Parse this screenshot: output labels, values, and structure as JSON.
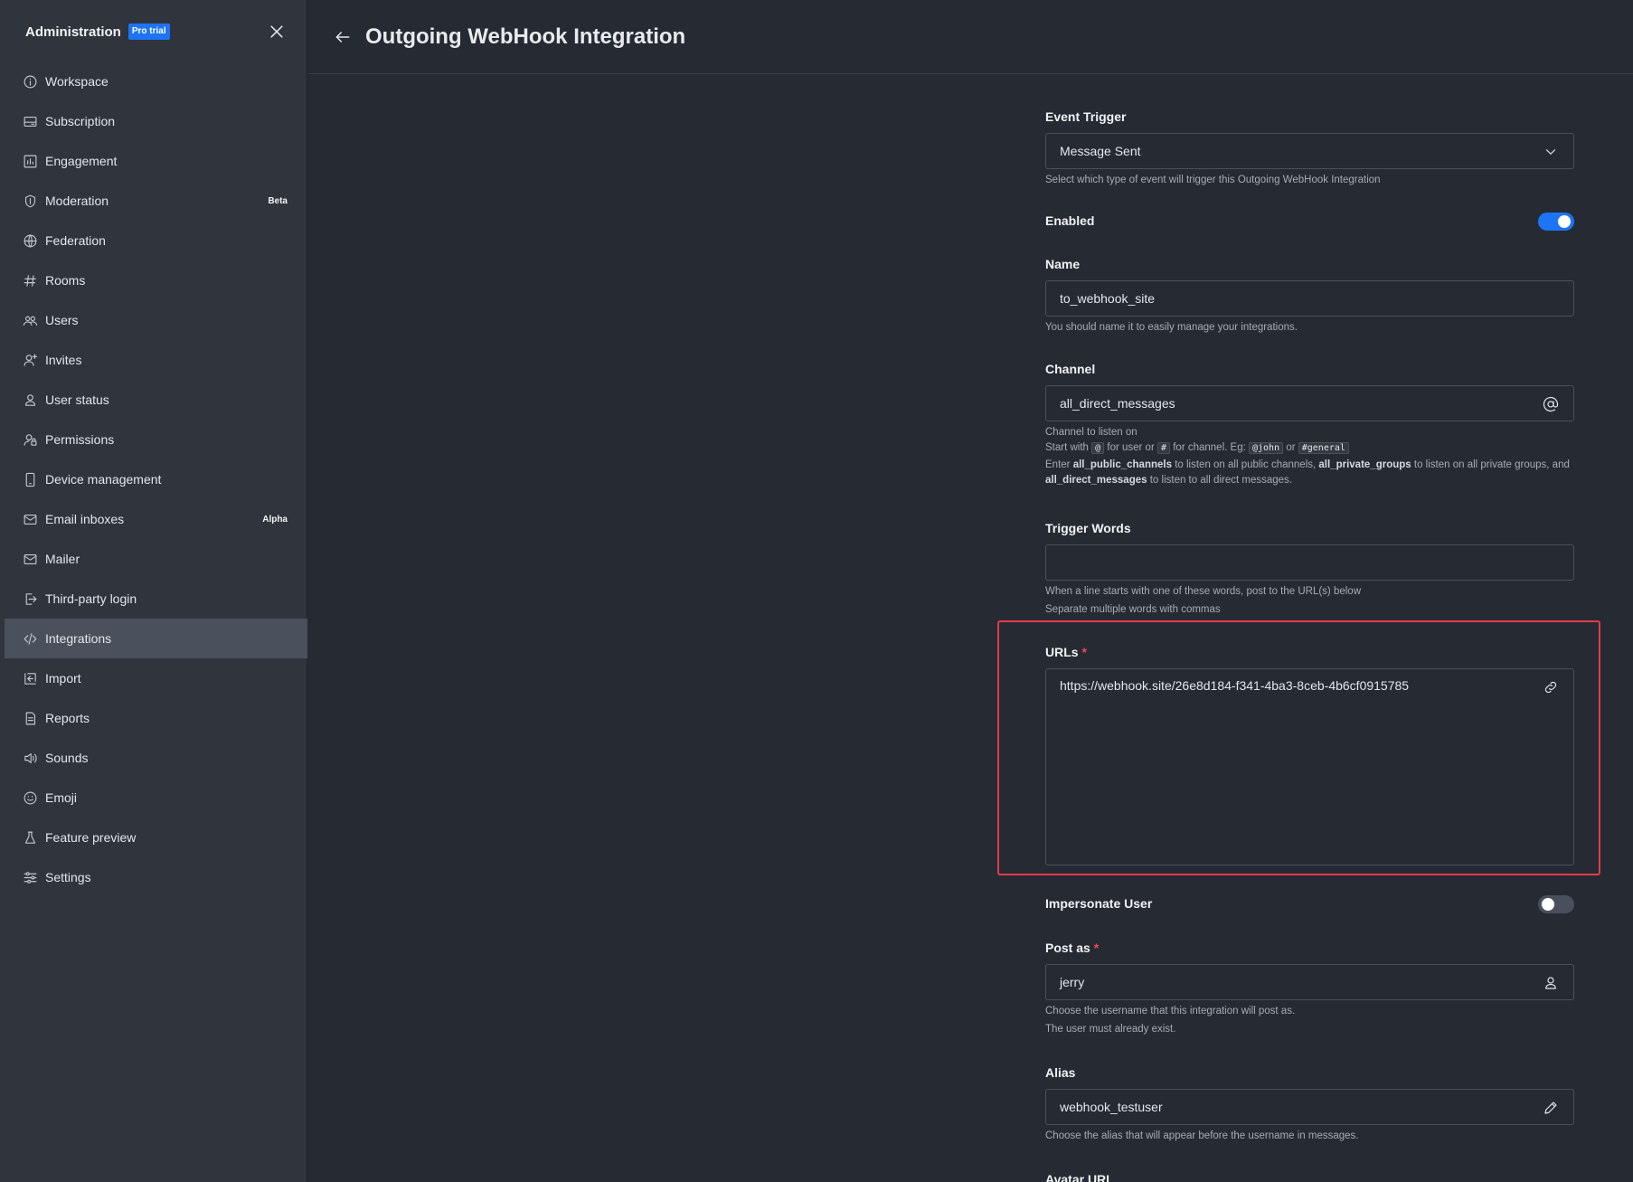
{
  "sidebar": {
    "title": "Administration",
    "badge": "Pro trial",
    "items": [
      {
        "label": "Workspace",
        "icon": "info-circle-icon"
      },
      {
        "label": "Subscription",
        "icon": "card-icon"
      },
      {
        "label": "Engagement",
        "icon": "bar-chart-icon"
      },
      {
        "label": "Moderation",
        "icon": "shield-icon",
        "tag": "Beta"
      },
      {
        "label": "Federation",
        "icon": "globe-icon"
      },
      {
        "label": "Rooms",
        "icon": "hashtag-icon"
      },
      {
        "label": "Users",
        "icon": "team-icon"
      },
      {
        "label": "Invites",
        "icon": "user-plus-icon"
      },
      {
        "label": "User status",
        "icon": "user-icon"
      },
      {
        "label": "Permissions",
        "icon": "user-lock-icon"
      },
      {
        "label": "Device management",
        "icon": "mobile-icon"
      },
      {
        "label": "Email inboxes",
        "icon": "mail-icon",
        "tag": "Alpha"
      },
      {
        "label": "Mailer",
        "icon": "mail-icon"
      },
      {
        "label": "Third-party login",
        "icon": "login-icon"
      },
      {
        "label": "Integrations",
        "icon": "code-icon",
        "active": true
      },
      {
        "label": "Import",
        "icon": "import-icon"
      },
      {
        "label": "Reports",
        "icon": "document-icon"
      },
      {
        "label": "Sounds",
        "icon": "speaker-icon"
      },
      {
        "label": "Emoji",
        "icon": "emoji-icon"
      },
      {
        "label": "Feature preview",
        "icon": "flask-icon"
      },
      {
        "label": "Settings",
        "icon": "sliders-icon"
      }
    ]
  },
  "header": {
    "title": "Outgoing WebHook Integration"
  },
  "form": {
    "event_trigger": {
      "label": "Event Trigger",
      "value": "Message Sent",
      "hint": "Select which type of event will trigger this Outgoing WebHook Integration"
    },
    "enabled": {
      "label": "Enabled",
      "value": true
    },
    "name": {
      "label": "Name",
      "value": "to_webhook_site",
      "hint": "You should name it to easily manage your integrations."
    },
    "channel": {
      "label": "Channel",
      "value": "all_direct_messages",
      "hint1": "Channel to listen on",
      "hint2_start": "Start with",
      "hint2_at": "@",
      "hint2_mid1": "for user or",
      "hint2_hash": "#",
      "hint2_mid2": "for channel. Eg:",
      "hint2_ex1": "@john",
      "hint2_or": "or",
      "hint2_ex2": "#general",
      "hint3_a": "Enter",
      "hint3_b": "all_public_channels",
      "hint3_c": "to listen on all public channels,",
      "hint3_d": "all_private_groups",
      "hint3_e": "to listen on all private groups,",
      "hint3_f": "and",
      "hint3_g": "all_direct_messages",
      "hint3_h": "to listen to all direct messages."
    },
    "trigger_words": {
      "label": "Trigger Words",
      "value": "",
      "hint1": "When a line starts with one of these words, post to the URL(s) below",
      "hint2": "Separate multiple words with commas"
    },
    "urls": {
      "label": "URLs",
      "required": "*",
      "value": "https://webhook.site/26e8d184-f341-4ba3-8ceb-4b6cf0915785"
    },
    "impersonate": {
      "label": "Impersonate User",
      "value": false
    },
    "post_as": {
      "label": "Post as",
      "required": "*",
      "value": "jerry",
      "hint1": "Choose the username that this integration will post as.",
      "hint2": "The user must already exist."
    },
    "alias": {
      "label": "Alias",
      "value": "webhook_testuser",
      "hint": "Choose the alias that will appear before the username in messages."
    },
    "avatar_url": {
      "label": "Avatar URL"
    }
  },
  "colors": {
    "accent": "#1d74f5",
    "highlight": "#e33b4c",
    "sidebar_bg": "#2f343d",
    "main_bg": "#262a33"
  }
}
